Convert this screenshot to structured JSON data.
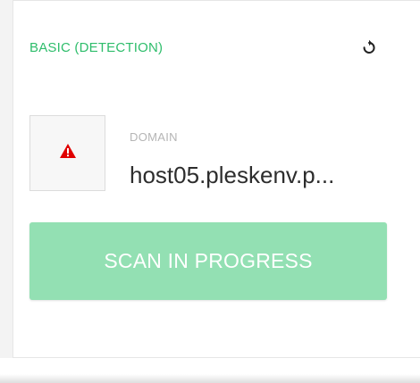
{
  "panel": {
    "title": "BASIC (DETECTION)",
    "refresh_icon": "refresh-icon"
  },
  "domain": {
    "status_icon": "warning-triangle-icon",
    "label": "DOMAIN",
    "value": "host05.pleskenv.p..."
  },
  "scan_button": {
    "label": "SCAN IN PROGRESS"
  },
  "colors": {
    "title_green": "#2ebd6b",
    "button_green": "#93e0b3",
    "warning_red": "#e00000"
  }
}
